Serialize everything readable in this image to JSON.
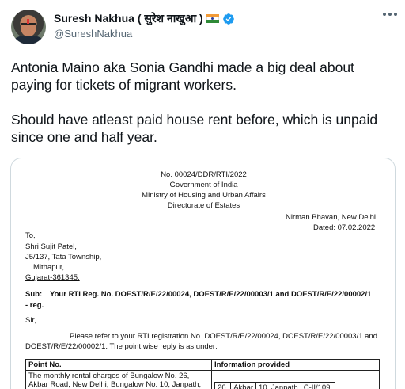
{
  "tweet": {
    "display_name": "Suresh Nakhua ( सुरेश नाखुआ )",
    "handle": "@SureshNakhua",
    "paragraph_1": "Antonia Maino aka Sonia Gandhi made a big deal about paying for tickets of migrant workers.",
    "paragraph_2": "Should have atleast paid house rent before, which is unpaid since one and half year.",
    "icons": {
      "verified": "verified-badge-icon",
      "flag": "india-flag-icon",
      "more": "more-options-icon"
    },
    "accent_color": "#1d9bf0"
  },
  "document": {
    "ref_no": "No. 00024/DDR/RTI/2022",
    "gov": "Government of India",
    "ministry": "Ministry of Housing and Urban Affairs",
    "directorate": "Directorate of Estates",
    "place": "Nirman Bhavan, New Delhi",
    "dated": "Dated:  07.02.2022",
    "to": "To,",
    "addr_1": "Shri Sujit Patel,",
    "addr_2": "J5/137, Tata Township,",
    "addr_3": "Mithapur,",
    "addr_4": "Gujarat-361345.",
    "sub_label": "Sub:",
    "sub_text": "Your RTI Reg. No. DOEST/R/E/22/00024, DOEST/R/E/22/00003/1 and DOEST/R/E/22/00002/1",
    "sub_text_2": "- reg.",
    "salutation": "Sir,",
    "body_1": "Please refer to your RTI registration No. DOEST/R/E/22/00024, DOEST/R/E/22/00003/1 and",
    "body_2": "DOEST/R/E/22/00002/1. The point wise reply is as under:",
    "table": {
      "col_1": "Point No.",
      "col_2": "Information provided",
      "row_1_text_1": "The monthly rental charges of Bungalow No. 26,",
      "row_1_text_2": "Akbar Road, New Delhi, Bungalow No. 10, Janpath,",
      "inner_1": "26,",
      "inner_2": "Akbar",
      "inner_3": "10, Janpath",
      "inner_4": "C-II/109,"
    }
  }
}
